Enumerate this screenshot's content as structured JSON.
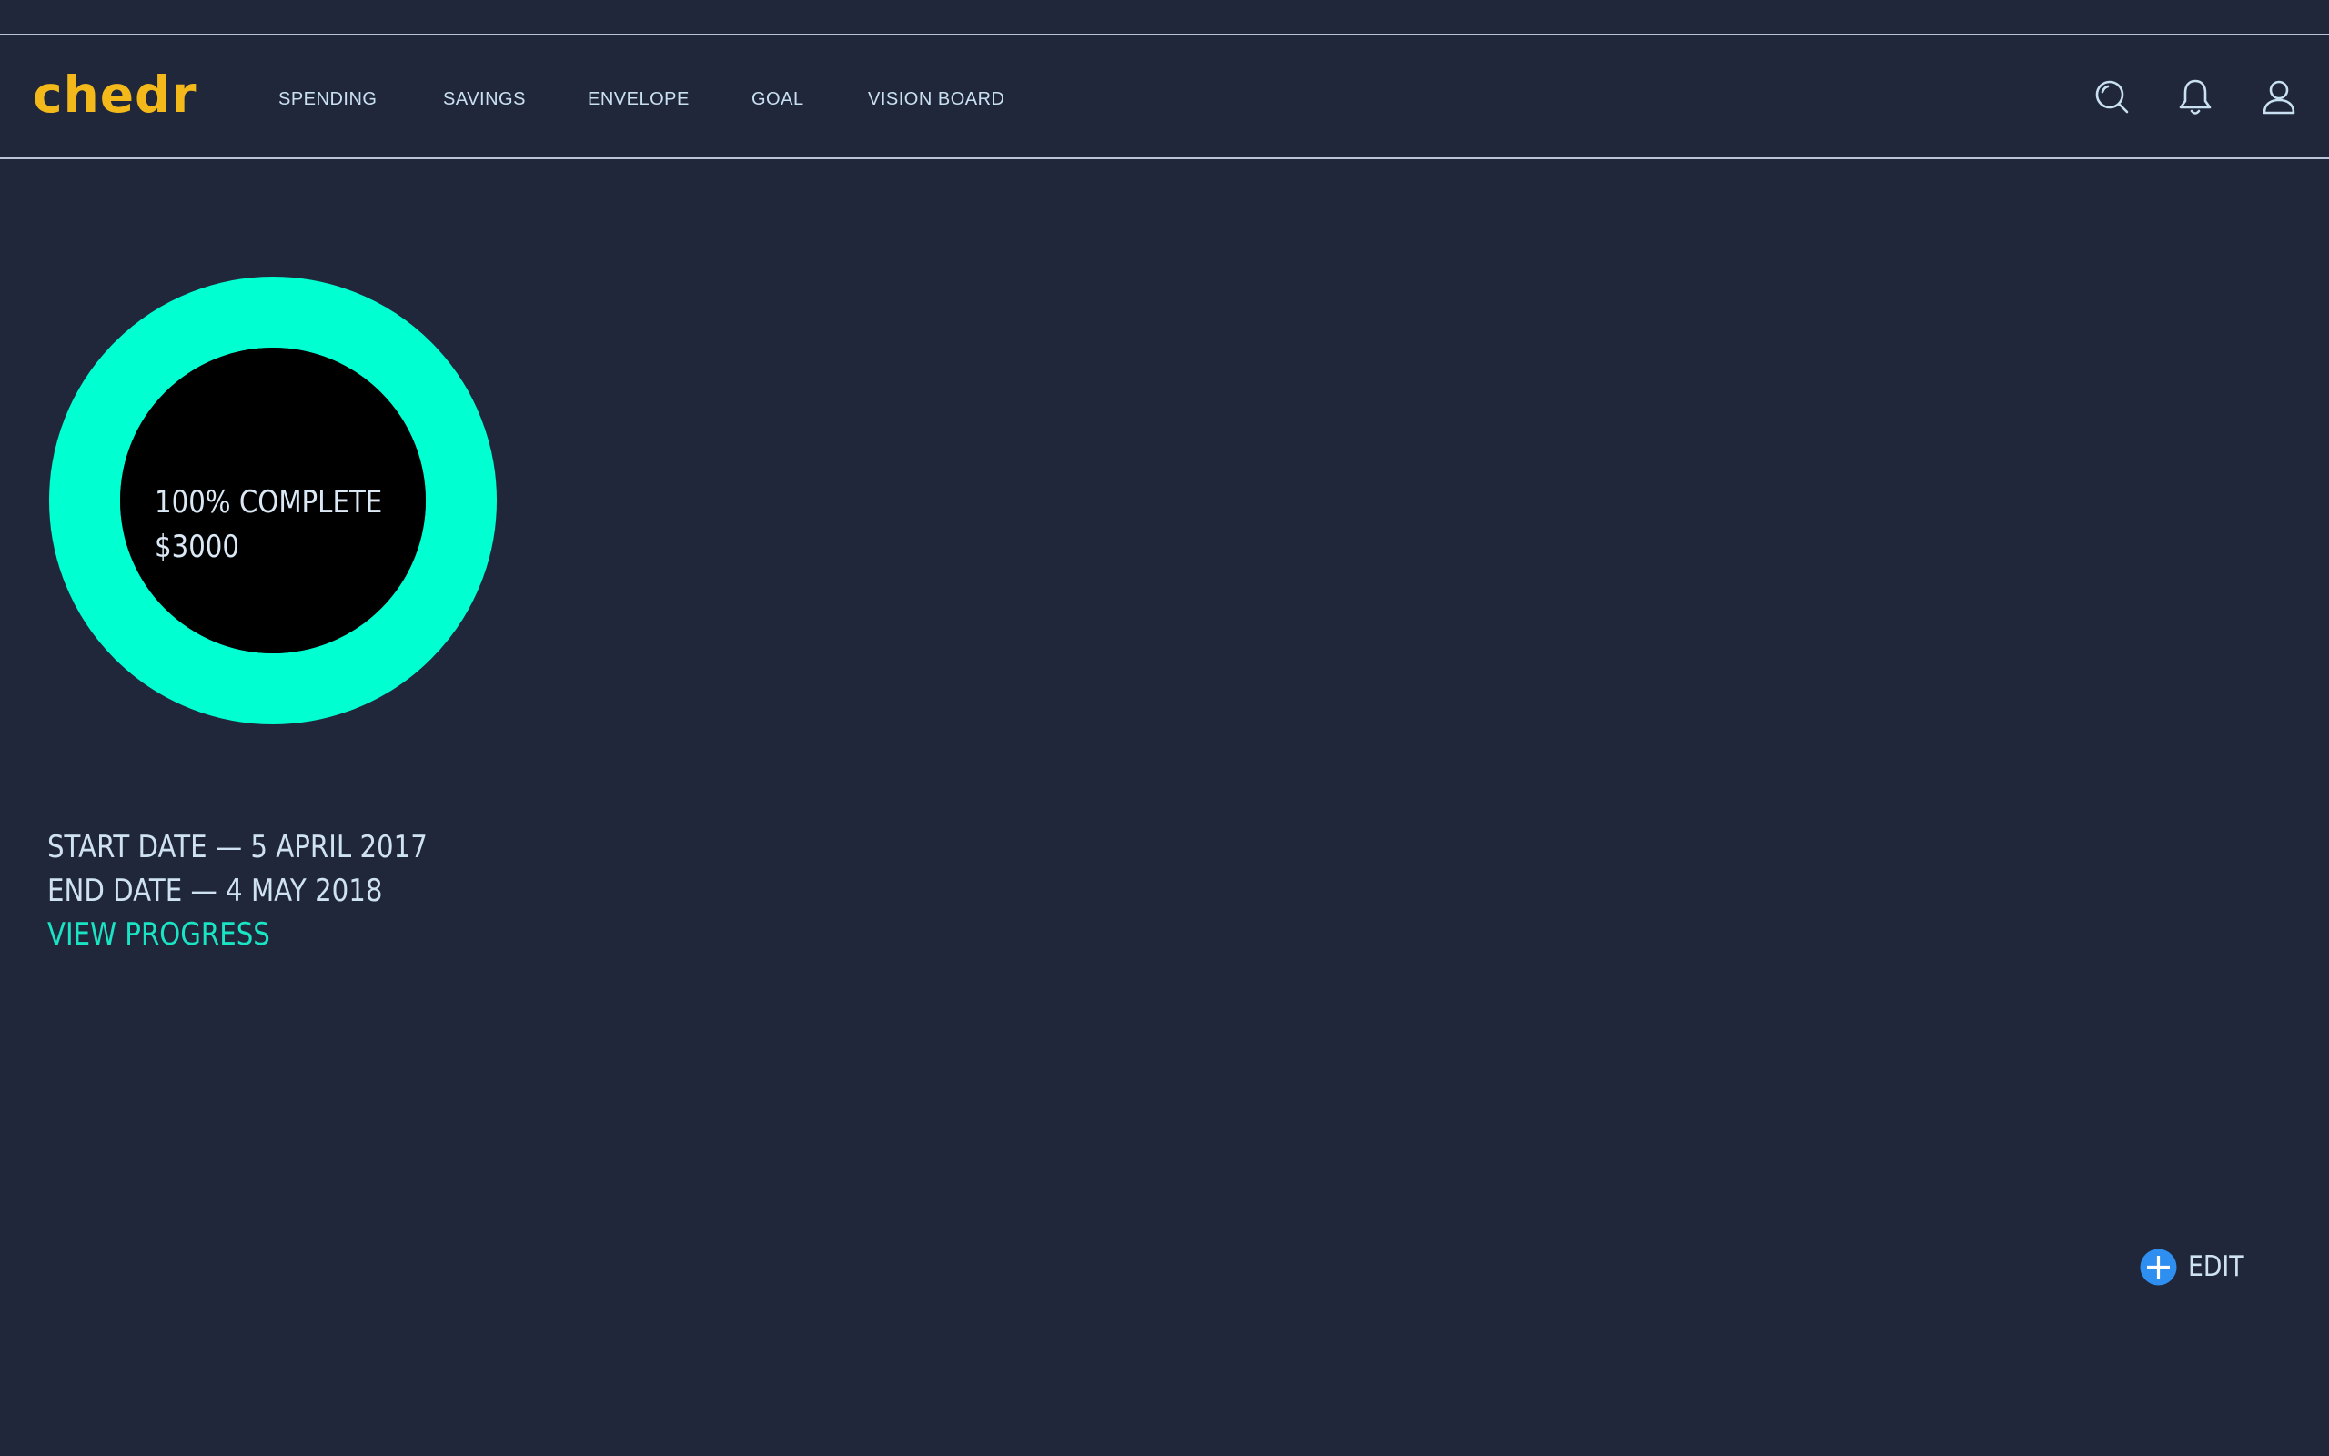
{
  "app": {
    "logo_text": "chedr",
    "brand_color": "#f3b91a",
    "accent_color": "#00ffd1"
  },
  "nav": {
    "items": [
      {
        "label": "SPENDING"
      },
      {
        "label": "SAVINGS"
      },
      {
        "label": "ENVELOPE"
      },
      {
        "label": "GOAL"
      },
      {
        "label": "VISION BOARD"
      }
    ]
  },
  "header_icons": [
    "search-icon",
    "bell-icon",
    "user-icon"
  ],
  "goal": {
    "progress_fraction": 1.0,
    "progress_label": "100% COMPLETE",
    "amount": "$3000",
    "start_date": "START DATE — 5 APRIL 2017",
    "end_date": "END DATE — 4 MAY 2018",
    "view_progress_label": "VIEW PROGRESS"
  },
  "actions": {
    "edit_label": "EDIT",
    "edit_icon": "plus-circle-icon",
    "edit_icon_color": "#2e8ff0"
  }
}
